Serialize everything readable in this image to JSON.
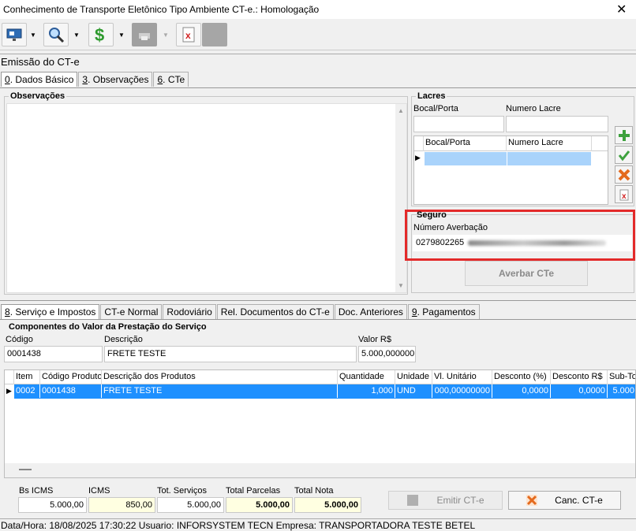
{
  "window": {
    "title": "Conhecimento de Transporte Eletônico Tipo Ambiente CT-e.: Homologação",
    "close": "✕"
  },
  "toolbar": {
    "icons": [
      "monitor-icon",
      "search-icon",
      "dollar-icon",
      "printer-icon",
      "cancel-doc-icon"
    ]
  },
  "section": {
    "title": "Emissão do CT-e"
  },
  "top_tabs": [
    {
      "key": "0",
      "rest": ". Dados Básico"
    },
    {
      "key": "3",
      "rest": ". Observações"
    },
    {
      "key": "6",
      "rest": ". CTe"
    }
  ],
  "observacoes": {
    "title": "Observações"
  },
  "lacres": {
    "title": "Lacres",
    "bocal_label": "Bocal/Porta",
    "numero_label": "Numero Lacre",
    "grid_headers": [
      "Bocal/Porta",
      "Numero Lacre"
    ]
  },
  "seguro": {
    "title": "Seguro",
    "averbacao_label": "Número Averbação",
    "averbacao_value": "0279802265",
    "averbar_button": "Averbar CTe"
  },
  "bottom_tabs": [
    {
      "key": "8",
      "rest": ". Serviço e Impostos"
    },
    {
      "key": "",
      "rest": "CT-e Normal"
    },
    {
      "key": "",
      "rest": "Rodoviário"
    },
    {
      "key": "",
      "rest": "Rel. Documentos do CT-e"
    },
    {
      "key": "",
      "rest": "Doc. Anteriores"
    },
    {
      "key": "9",
      "rest": ". Pagamentos"
    }
  ],
  "componentes": {
    "title": "Componentes do Valor da Prestação do Serviço",
    "codigo_label": "Código",
    "descricao_label": "Descrição",
    "valor_label": "Valor R$",
    "codigo": "0001438",
    "descricao": "FRETE TESTE",
    "valor": "5.000,000000"
  },
  "items_grid": {
    "headers": [
      "Item",
      "Código Produto",
      "Descrição dos Produtos",
      "Quantidade",
      "Unidade",
      "Vl. Unitário",
      "Desconto (%)",
      "Desconto R$",
      "Sub-To"
    ],
    "rows": [
      [
        "0002",
        "0001438",
        "FRETE TESTE",
        "1,000",
        "UND",
        "000,00000000",
        "0,0000",
        "0,0000",
        "5.000"
      ]
    ]
  },
  "totals": {
    "bs_icms_label": "Bs ICMS",
    "bs_icms": "5.000,00",
    "icms_label": "ICMS",
    "icms": "850,00",
    "tot_servicos_label": "Tot. Serviços",
    "tot_servicos": "5.000,00",
    "total_parcelas_label": "Total Parcelas",
    "total_parcelas": "5.000,00",
    "total_nota_label": "Total Nota",
    "total_nota": "5.000,00"
  },
  "actions": {
    "emitir": "Emitir CT-e",
    "cancelar": "Canc. CT-e"
  },
  "status": {
    "text": "Data/Hora: 18/08/2025 17:30:22  Usuario: INFORSYSTEM TECN Empresa: TRANSPORTADORA TESTE BETEL"
  }
}
